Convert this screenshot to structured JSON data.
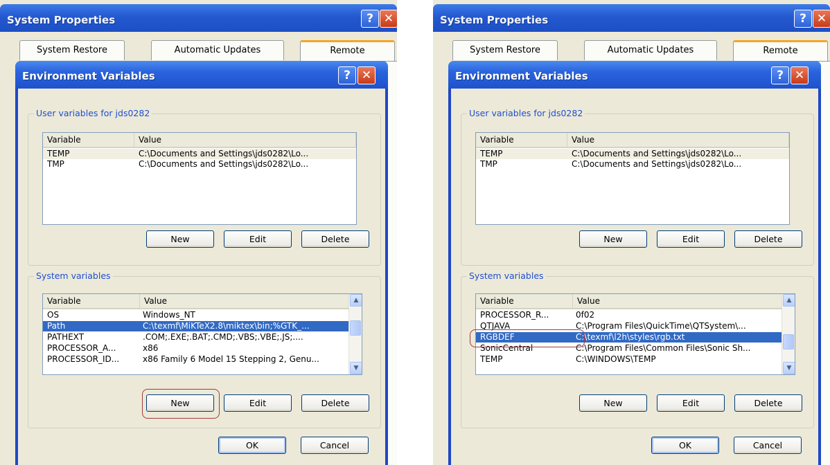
{
  "shots": [
    {
      "system_properties": {
        "title": "System Properties",
        "tabs": [
          "System Restore",
          "Automatic Updates",
          "Remote"
        ]
      },
      "env_dialog": {
        "title": "Environment Variables",
        "user_group_label": "User variables for jds0282",
        "user_columns": [
          "Variable",
          "Value"
        ],
        "user_rows": [
          {
            "variable": "TEMP",
            "value": "C:\\Documents and Settings\\jds0282\\Lo..."
          },
          {
            "variable": "TMP",
            "value": "C:\\Documents and Settings\\jds0282\\Lo..."
          }
        ],
        "user_buttons": {
          "new": "New",
          "edit": "Edit",
          "delete": "Delete"
        },
        "system_group_label": "System variables",
        "system_columns": [
          "Variable",
          "Value"
        ],
        "system_rows": [
          {
            "variable": "OS",
            "value": "Windows_NT"
          },
          {
            "variable": "Path",
            "value": "C:\\texmf\\MiKTeX2.8\\miktex\\bin;%GTK_..."
          },
          {
            "variable": "PATHEXT",
            "value": ".COM;.EXE;.BAT;.CMD;.VBS;.VBE;.JS;...."
          },
          {
            "variable": "PROCESSOR_A...",
            "value": "x86"
          },
          {
            "variable": "PROCESSOR_ID...",
            "value": "x86 Family 6 Model 15 Stepping 2, Genu..."
          }
        ],
        "system_buttons": {
          "new": "New",
          "edit": "Edit",
          "delete": "Delete"
        },
        "ok": "OK",
        "cancel": "Cancel"
      }
    },
    {
      "system_properties": {
        "title": "System Properties",
        "tabs": [
          "System Restore",
          "Automatic Updates",
          "Remote"
        ]
      },
      "env_dialog": {
        "title": "Environment Variables",
        "user_group_label": "User variables for jds0282",
        "user_columns": [
          "Variable",
          "Value"
        ],
        "user_rows": [
          {
            "variable": "TEMP",
            "value": "C:\\Documents and Settings\\jds0282\\Lo..."
          },
          {
            "variable": "TMP",
            "value": "C:\\Documents and Settings\\jds0282\\Lo..."
          }
        ],
        "user_buttons": {
          "new": "New",
          "edit": "Edit",
          "delete": "Delete"
        },
        "system_group_label": "System variables",
        "system_columns": [
          "Variable",
          "Value"
        ],
        "system_rows": [
          {
            "variable": "PROCESSOR_R...",
            "value": "0f02"
          },
          {
            "variable": "QTJAVA",
            "value": "C:\\Program Files\\QuickTime\\QTSystem\\..."
          },
          {
            "variable": "RGBDEF",
            "value": "C:\\texmf\\l2h\\styles\\rgb.txt"
          },
          {
            "variable": "SonicCentral",
            "value": "C:\\Program Files\\Common Files\\Sonic Sh..."
          },
          {
            "variable": "TEMP",
            "value": "C:\\WINDOWS\\TEMP"
          }
        ],
        "system_buttons": {
          "new": "New",
          "edit": "Edit",
          "delete": "Delete"
        },
        "ok": "OK",
        "cancel": "Cancel"
      }
    }
  ]
}
